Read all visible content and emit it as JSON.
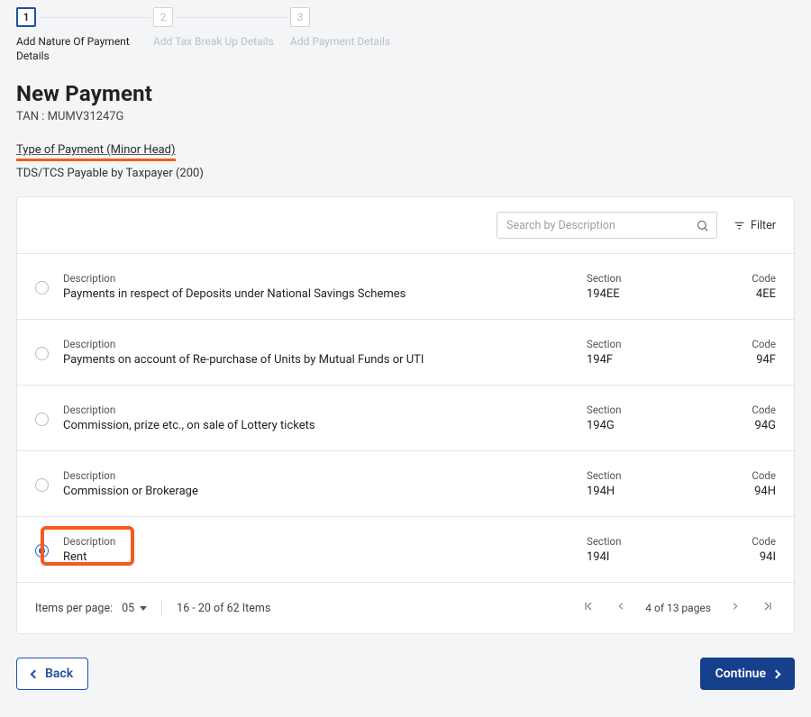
{
  "stepper": {
    "steps": [
      {
        "num": "1",
        "label": "Add Nature Of Payment Details",
        "active": true
      },
      {
        "num": "2",
        "label": "Add Tax Break Up Details",
        "active": false
      },
      {
        "num": "3",
        "label": "Add Payment Details",
        "active": false
      }
    ]
  },
  "page": {
    "title": "New Payment",
    "tan_label": "TAN :",
    "tan_value": "MUMV31247G",
    "type_link": "Type of Payment (Minor Head)",
    "type_value": "TDS/TCS Payable by Taxpayer (200)"
  },
  "search": {
    "placeholder": "Search by Description"
  },
  "filter_label": "Filter",
  "cols": {
    "desc": "Description",
    "section": "Section",
    "code": "Code"
  },
  "rows": [
    {
      "desc": "Payments in respect of Deposits under National Savings Schemes",
      "section": "194EE",
      "code": "4EE",
      "selected": false
    },
    {
      "desc": "Payments on account of Re-purchase of Units by Mutual Funds or UTI",
      "section": "194F",
      "code": "94F",
      "selected": false
    },
    {
      "desc": "Commission, prize etc., on sale of Lottery tickets",
      "section": "194G",
      "code": "94G",
      "selected": false
    },
    {
      "desc": "Commission or Brokerage",
      "section": "194H",
      "code": "94H",
      "selected": false
    },
    {
      "desc": "Rent",
      "section": "194I",
      "code": "94I",
      "selected": true
    }
  ],
  "pager": {
    "items_per_page_label": "Items per page:",
    "items_per_page": "05",
    "range": "16 - 20 of 62 Items",
    "page_of": "4 of 13 pages"
  },
  "footer": {
    "back": "Back",
    "continue": "Continue"
  }
}
